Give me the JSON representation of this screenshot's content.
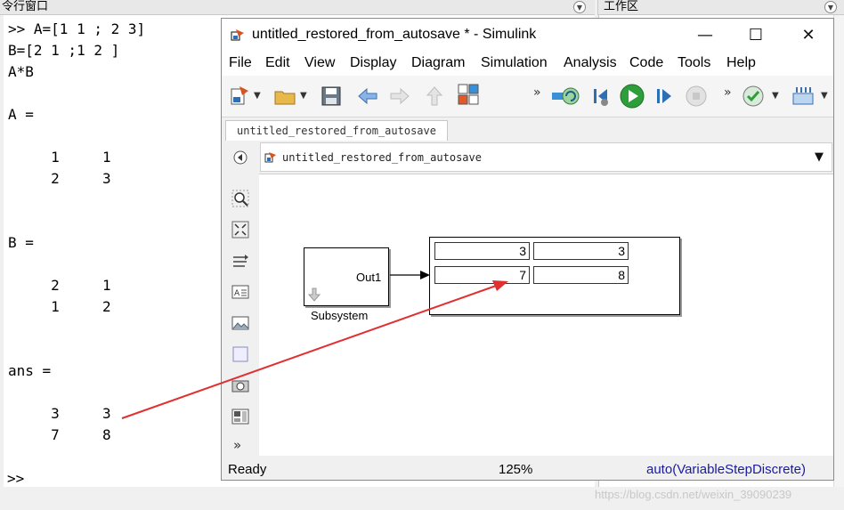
{
  "matlab": {
    "command_window_title": "令行窗口",
    "workspace_title": "工作区",
    "command_lines": [
      ">> A=[1 1 ; 2 3]",
      "B=[2 1 ;1 2 ]",
      "A*B",
      "",
      "A =",
      "",
      "     1     1",
      "     2     3",
      "",
      "",
      "B =",
      "",
      "     2     1",
      "     1     2",
      "",
      "",
      "ans =",
      "",
      "     3     3",
      "     7     8"
    ],
    "prompt": ">>"
  },
  "simulink": {
    "window_title": "untitled_restored_from_autosave * - Simulink",
    "window_buttons": {
      "minimize": "—",
      "maximize": "☐",
      "close": "✕"
    },
    "menu": [
      "File",
      "Edit",
      "View",
      "Display",
      "Diagram",
      "Simulation",
      "Analysis",
      "Code",
      "Tools",
      "Help"
    ],
    "tab_label": "untitled_restored_from_autosave",
    "address": "untitled_restored_from_autosave",
    "status": {
      "left": "Ready",
      "zoom": "125%",
      "solver": "auto(VariableStepDiscrete)"
    },
    "subsystem": {
      "port_label": "Out1",
      "name": "Subsystem"
    },
    "display": {
      "values": [
        "3",
        "3",
        "7",
        "8"
      ]
    },
    "toolbar_chevron": "»"
  },
  "watermark": "https://blog.csdn.net/weixin_39090239",
  "colors": {
    "annotation_arrow": "#e03030",
    "run_green": "#2e9e3a",
    "solver_text": "#1a1aa0"
  }
}
